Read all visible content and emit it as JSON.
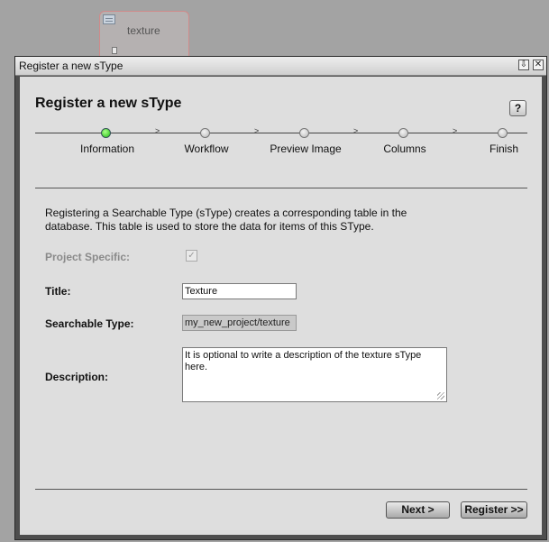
{
  "background_node": {
    "label": "texture"
  },
  "window": {
    "title": "Register a new sType"
  },
  "dialog": {
    "heading": "Register a new sType",
    "help_label": "?",
    "steps": [
      {
        "label": "Information",
        "active": true
      },
      {
        "label": "Workflow",
        "active": false
      },
      {
        "label": "Preview Image",
        "active": false
      },
      {
        "label": "Columns",
        "active": false
      },
      {
        "label": "Finish",
        "active": false
      }
    ],
    "step_arrow": ">",
    "intro_text": "Registering a Searchable Type (sType) creates a corresponding table in the database. This table is used to store the data for items of this SType.",
    "form": {
      "project_specific_label": "Project Specific:",
      "project_specific_checked": true,
      "title_label": "Title:",
      "title_value": "Texture",
      "searchable_type_label": "Searchable Type:",
      "searchable_type_value": "my_new_project/texture",
      "description_label": "Description:",
      "description_value": "It is optional to write a description of the texture sType here."
    },
    "buttons": {
      "next": "Next >",
      "register": "Register >>"
    }
  },
  "icons": {
    "node": "table-icon",
    "minimize": "download-arrow-icon",
    "close": "close-icon",
    "check": "checkmark-icon",
    "status_active": "green-dot-icon"
  },
  "colors": {
    "active_step": "#22c011",
    "dialog_bg": "#dedede",
    "window_frame": "#4e4e4e"
  }
}
